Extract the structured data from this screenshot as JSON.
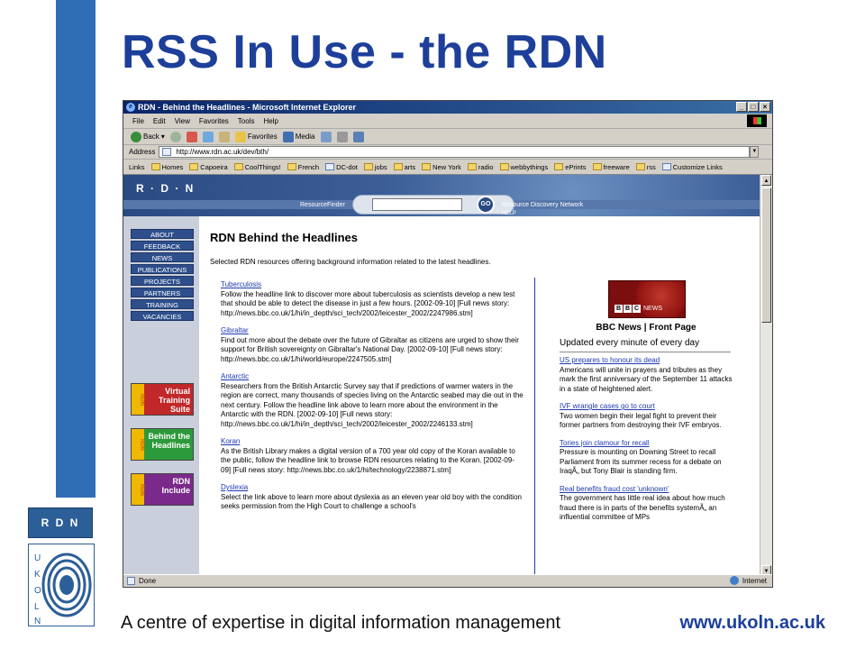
{
  "slide": {
    "title": "RSS In Use - the RDN",
    "footer_text": "A centre of expertise in digital information management",
    "footer_url": "www.ukoln.ac.uk",
    "rdn_logo": "R D N"
  },
  "browser": {
    "window_title": "RDN - Behind the Headlines - Microsoft Internet Explorer",
    "menu": [
      "File",
      "Edit",
      "View",
      "Favorites",
      "Tools",
      "Help"
    ],
    "toolbar": {
      "back": "Back",
      "favorites": "Favorites",
      "media": "Media"
    },
    "address_label": "Address",
    "address_value": "http://www.rdn.ac.uk/dev/bth/",
    "links_label": "Links",
    "links": [
      "Homes",
      "Capoeira",
      "CoolThings!",
      "French",
      "DC-dot",
      "jobs",
      "arts",
      "New York",
      "radio",
      "webbythings",
      "ePrints",
      "freeware",
      "rss",
      "Customize Links"
    ],
    "status_left": "Done",
    "status_zone": "Internet"
  },
  "rdn_page": {
    "logo": "R · D · N",
    "resource_finder": "ResourceFinder",
    "go": "GO",
    "network": "Resource Discovery Network",
    "help": "HELP",
    "nav": [
      "ABOUT",
      "FEEDBACK",
      "NEWS",
      "PUBLICATIONS",
      "PROJECTS",
      "PARTNERS",
      "TRAINING",
      "VACANCIES"
    ],
    "promos": [
      {
        "text": "Virtual Training Suite",
        "color": "#c0282a"
      },
      {
        "text": "Behind the Headlines",
        "color": "#2c9a3a"
      },
      {
        "text": "RDN Include",
        "color": "#7a2a8a"
      }
    ],
    "heading": "RDN Behind the Headlines",
    "intro": "Selected RDN resources offering background information related to the latest headlines.",
    "items": [
      {
        "title": "Tuberculosis",
        "body": "Follow the headline link to discover more about tuberculosis as scientists develop a new test that should be able to detect the disease in just a few hours. [2002-09-10] [Full news story: http://news.bbc.co.uk/1/hi/in_depth/sci_tech/2002/leicester_2002/2247986.stm]"
      },
      {
        "title": "Gibraltar",
        "body": "Find out more about the debate over the future of Gibraltar as citizens are urged to show their support for British sovereignty on Gibraltar's National Day. [2002-09-10] [Full news story: http://news.bbc.co.uk/1/hi/world/europe/2247505.stm]"
      },
      {
        "title": "Antarctic",
        "body": "Researchers from the British Antarctic Survey say that if predictions of warmer waters in the region are correct, many thousands of species living on the Antarctic seabed may die out in the next century. Follow the headline link above to learn more about the environment in the Antarctic with the RDN. [2002-09-10] [Full news story: http://news.bbc.co.uk/1/hi/in_depth/sci_tech/2002/leicester_2002/2246133.stm]"
      },
      {
        "title": "Koran",
        "body": "As the British Library makes a digital version of a 700 year old copy of the Koran available to the public, follow the headline link to browse RDN resources relating to the Koran. [2002-09-09] [Full news story: http://news.bbc.co.uk/1/hi/technology/2238871.stm]"
      },
      {
        "title": "Dyslexia",
        "body": "Select the link above to learn more about dyslexia as an eleven year old boy with the condition seeks permission from the High Court to challenge a school's"
      }
    ],
    "bbc": {
      "logo_letters": [
        "B",
        "B",
        "C"
      ],
      "logo_news": "NEWS",
      "title": "BBC News | Front Page",
      "subtitle": "Updated every minute of every day",
      "items": [
        {
          "title": "US prepares to honour its dead",
          "body": "Americans will unite in prayers and tributes as they mark the first anniversary of the September 11 attacks in a state of heightened alert."
        },
        {
          "title": "IVF wrangle cases go to court",
          "body": "Two women begin their legal fight to prevent their former partners from destroying their IVF embryos."
        },
        {
          "title": "Tories join clamour for recall",
          "body": "Pressure is mounting on Downing Street to recall Parliament from its summer recess for a debate on IraqÃ„ but Tony Blair is standing firm."
        },
        {
          "title": "Real benefits fraud cost 'unknown'",
          "body": "The government has little real idea about how much fraud there is in parts of the benefits systemÃ„ an influential committee of MPs"
        }
      ]
    }
  }
}
